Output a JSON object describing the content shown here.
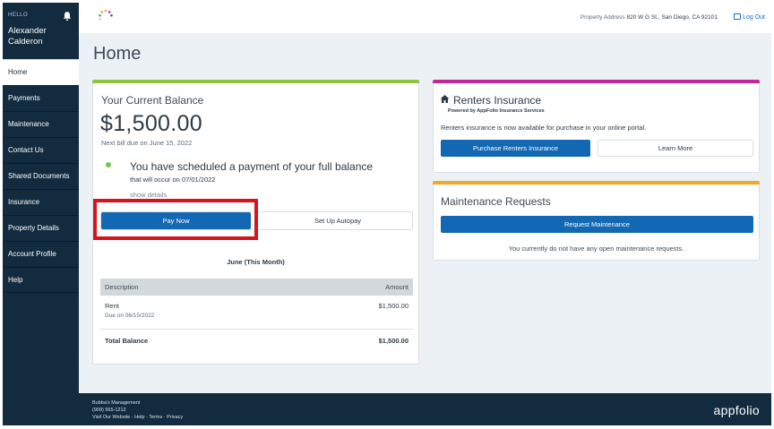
{
  "sidebar": {
    "greeting": "HELLO",
    "user_name_line1": "Alexander",
    "user_name_line2": "Calderon",
    "items": [
      {
        "label": "Home"
      },
      {
        "label": "Payments"
      },
      {
        "label": "Maintenance"
      },
      {
        "label": "Contact Us"
      },
      {
        "label": "Shared Documents"
      },
      {
        "label": "Insurance"
      },
      {
        "label": "Property Details"
      },
      {
        "label": "Account Profile"
      },
      {
        "label": "Help"
      }
    ]
  },
  "header": {
    "property_label": "Property Address",
    "property_address": "820 W G St., San Diego, CA 92101",
    "logout_label": "Log Out"
  },
  "page": {
    "title": "Home"
  },
  "balance": {
    "title": "Your Current Balance",
    "amount": "$1,500.00",
    "due_text": "Next bill due on June 15, 2022",
    "scheduled_text": "You have scheduled a payment of your full balance",
    "scheduled_sub": "that will occur on 07/01/2022",
    "show_details": "show details",
    "pay_now_label": "Pay Now",
    "autopay_label": "Set Up Autopay",
    "month_label": "June (This Month)",
    "table": {
      "col_description": "Description",
      "col_amount": "Amount",
      "rows": [
        {
          "description": "Rent",
          "sub": "Due on 06/15/2022",
          "amount": "$1,500.00"
        }
      ],
      "total_label": "Total Balance",
      "total_amount": "$1,500.00"
    }
  },
  "renters": {
    "title": "Renters Insurance",
    "powered_by": "Powered by AppFolio Insurance Services",
    "description": "Renters insurance is now available for purchase in your online portal.",
    "purchase_label": "Purchase Renters Insurance",
    "learn_more_label": "Learn More"
  },
  "maintenance": {
    "title": "Maintenance Requests",
    "request_label": "Request Maintenance",
    "none_text": "You currently do not have any open maintenance requests."
  },
  "footer": {
    "company": "Bubba's Management",
    "phone": "(909) 555-1212",
    "links": "Visit Our Website  ·  Help  ·  Terms  ·  Privacy",
    "brand": "appfolio"
  },
  "colors": {
    "sidebar_bg": "#122b3f",
    "primary_button": "#1268b3",
    "balance_accent": "#8cc63f",
    "renters_accent": "#c4269a",
    "maintenance_accent": "#f5a623",
    "highlight": "#d9131b"
  }
}
